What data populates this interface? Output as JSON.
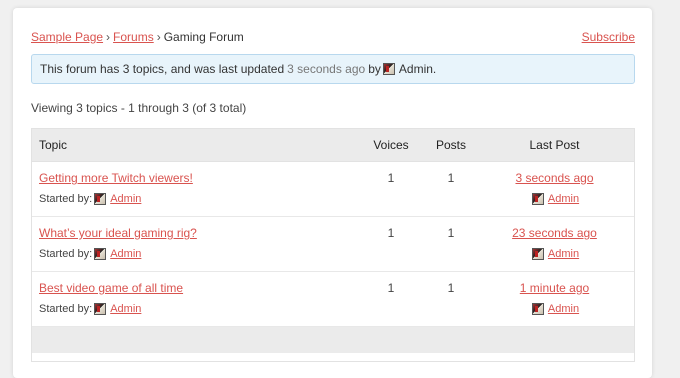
{
  "breadcrumb": {
    "items": [
      "Sample Page",
      "Forums"
    ],
    "separator": "›",
    "current": "Gaming Forum"
  },
  "subscribe_label": "Subscribe",
  "notice": {
    "prefix": "This forum has 3 topics, and was last updated",
    "time": "3 seconds ago",
    "by": "by",
    "author": "Admin",
    "suffix": "."
  },
  "viewing_text": "Viewing 3 topics - 1 through 3 (of 3 total)",
  "table": {
    "headers": {
      "topic": "Topic",
      "voices": "Voices",
      "posts": "Posts",
      "last_post": "Last Post"
    },
    "started_by_label": "Started by:",
    "rows": [
      {
        "title": "Getting more Twitch viewers!",
        "author": "Admin",
        "voices": "1",
        "posts": "1",
        "last_post_time": "3 seconds ago",
        "last_post_author": "Admin"
      },
      {
        "title": "What’s your ideal gaming rig?",
        "author": "Admin",
        "voices": "1",
        "posts": "1",
        "last_post_time": "23 seconds ago",
        "last_post_author": "Admin"
      },
      {
        "title": "Best video game of all time",
        "author": "Admin",
        "voices": "1",
        "posts": "1",
        "last_post_time": "1 minute ago",
        "last_post_author": "Admin"
      }
    ]
  },
  "colors": {
    "link": "#d9534f",
    "notice_bg": "#e8f4fb",
    "header_bg": "#ebebeb"
  }
}
